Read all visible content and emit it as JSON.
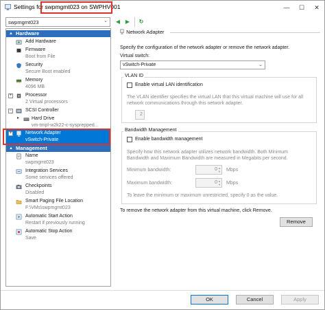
{
  "window": {
    "title_prefix": "Settings for ",
    "title_vm": "swpmgmt023 on SWPHV001",
    "minimize": "—",
    "maximize": "☐",
    "close": "✕"
  },
  "toolbar": {
    "vm_selected": "swpmgmt023",
    "back_icon": "◀",
    "forward_icon": "▶",
    "refresh_icon": "↻"
  },
  "sidebar": {
    "hardware_header": "Hardware",
    "management_header": "Management",
    "hardware_items": [
      {
        "label": "Add Hardware",
        "sub": ""
      },
      {
        "label": "Firmware",
        "sub": "Boot from File"
      },
      {
        "label": "Security",
        "sub": "Secure Boot enabled"
      },
      {
        "label": "Memory",
        "sub": "4096 MB"
      },
      {
        "label": "Processor",
        "sub": "2 Virtual processors"
      },
      {
        "label": "SCSI Controller",
        "sub": ""
      },
      {
        "label": "Hard Drive",
        "sub": "vm-tmpl-w2k22-c-sysprepped..."
      },
      {
        "label": "Network Adapter",
        "sub": "vSwitch-Private"
      }
    ],
    "management_items": [
      {
        "label": "Name",
        "sub": "swpmgmt023"
      },
      {
        "label": "Integration Services",
        "sub": "Some services offered"
      },
      {
        "label": "Checkpoints",
        "sub": "Disabled"
      },
      {
        "label": "Smart Paging File Location",
        "sub": "F:\\VMs\\swpmgmt023"
      },
      {
        "label": "Automatic Start Action",
        "sub": "Restart if previously running"
      },
      {
        "label": "Automatic Stop Action",
        "sub": "Save"
      }
    ]
  },
  "main": {
    "title": "Network Adapter",
    "description": "Specify the configuration of the network adapter or remove the network adapter.",
    "virtual_switch_label": "Virtual switch:",
    "virtual_switch_value": "vSwitch-Private",
    "vlan_group": "VLAN ID",
    "vlan_checkbox": "Enable virtual LAN identification",
    "vlan_help_1": "The VLAN identifier specifies the virtual LAN that this virtual machine will use for all",
    "vlan_help_2": "network communications through this network adapter.",
    "vlan_value": "2",
    "bw_group": "Bandwidth Management",
    "bw_checkbox": "Enable bandwidth management",
    "bw_help_1": "Specify how this network adapter utilizes network bandwidth. Both Minimum",
    "bw_help_2": "Bandwidth and Maximum Bandwidth are measured in Megabits per second.",
    "min_bw_label": "Minimum bandwidth:",
    "min_bw_value": "0",
    "min_bw_unit": "Mbps",
    "max_bw_label": "Maximum bandwidth:",
    "max_bw_value": "0",
    "max_bw_unit": "Mbps",
    "bw_note": "To leave the minimum or maximum unrestricted, specify 0 as the value.",
    "remove_text": "To remove the network adapter from this virtual machine, click Remove.",
    "remove_button": "Remove"
  },
  "footer": {
    "ok": "OK",
    "cancel": "Cancel",
    "apply": "Apply"
  },
  "colors": {
    "selection": "#0078d7",
    "section_header": "#2d6ebd",
    "highlight_box": "#e0302b"
  }
}
